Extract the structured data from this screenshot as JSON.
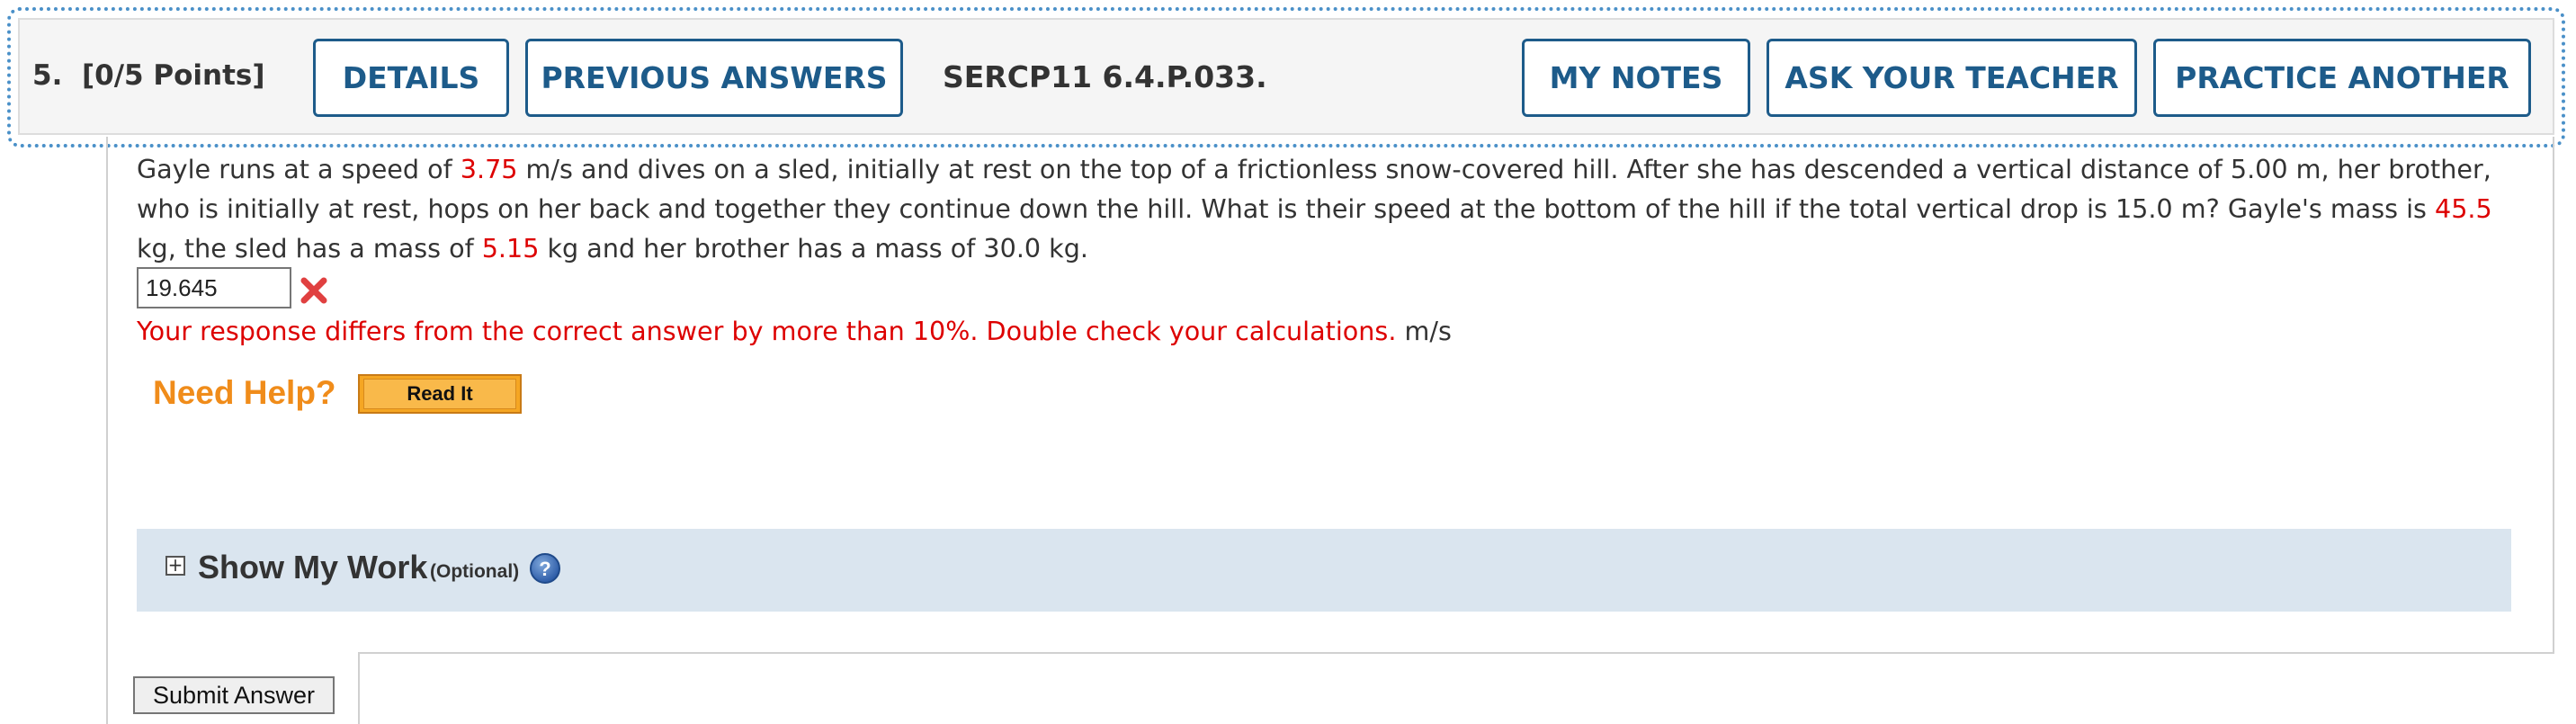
{
  "header": {
    "question_number": "5.",
    "points": "[0/5 Points]",
    "details_label": "DETAILS",
    "previous_answers_label": "PREVIOUS ANSWERS",
    "problem_code": "SERCP11 6.4.P.033.",
    "my_notes_label": "MY NOTES",
    "ask_teacher_label": "ASK YOUR TEACHER",
    "practice_another_label": "PRACTICE ANOTHER"
  },
  "question": {
    "t1": "Gayle runs at a speed of ",
    "v1": "3.75",
    "t2": " m/s and dives on a sled, initially at rest on the top of a frictionless snow-covered hill. After she has descended a vertical distance of 5.00 m, her brother, who is initially at rest, hops on her back and together they continue down the hill. What is their speed at the bottom of the hill if the total vertical drop is 15.0 m? Gayle's mass is ",
    "v2": "45.5",
    "t3": " kg, the sled has a mass of ",
    "v3": "5.15",
    "t4": " kg and her brother has a mass of 30.0 kg."
  },
  "answer": {
    "value": "19.645",
    "status_icon": "incorrect-x-icon",
    "feedback": "Your response differs from the correct answer by more than 10%. Double check your calculations.",
    "unit": "m/s"
  },
  "help": {
    "need_help_label": "Need Help?",
    "read_it_label": "Read It"
  },
  "work": {
    "expand_symbol": "+",
    "title": "Show My Work",
    "optional": "(Optional)",
    "help_icon": "?"
  },
  "submit_label": "Submit Answer",
  "colors": {
    "accent": "#1d5b8a",
    "error": "#dd0000",
    "help_orange": "#f08c1a",
    "work_bar": "#dae5ef"
  }
}
